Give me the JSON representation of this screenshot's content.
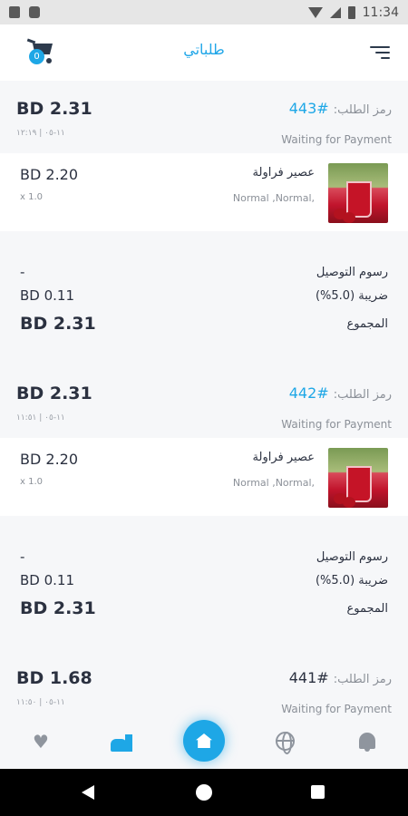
{
  "status_bar": {
    "time": "11:34"
  },
  "app_bar": {
    "title": "طلباتي",
    "cart_count": "0"
  },
  "orders": [
    {
      "price": "BD 2.31",
      "date": "١١-٠٥ | ١٢:١٩",
      "code_label": "رمز الطلب:",
      "code_number": "#443",
      "status": "Waiting for Payment",
      "item": {
        "price": "BD 2.20",
        "qty": "x 1.0",
        "name": "عصير فراولة",
        "options": "Normal ,Normal,"
      },
      "totals": {
        "delivery_label": "رسوم التوصيل",
        "delivery_value": "-",
        "tax_label": "ضريبة (5.0%)",
        "tax_value": "BD 0.11",
        "total_label": "المجموع",
        "total_value": "BD 2.31"
      }
    },
    {
      "price": "BD 2.31",
      "date": "١١-٠٥ | ١١:٥١",
      "code_label": "رمز الطلب:",
      "code_number": "#442",
      "status": "Waiting for Payment",
      "item": {
        "price": "BD 2.20",
        "qty": "x 1.0",
        "name": "عصير فراولة",
        "options": "Normal ,Normal,"
      },
      "totals": {
        "delivery_label": "رسوم التوصيل",
        "delivery_value": "-",
        "tax_label": "ضريبة (5.0%)",
        "tax_value": "BD 0.11",
        "total_label": "المجموع",
        "total_value": "BD 2.31"
      }
    },
    {
      "price": "BD 1.68",
      "date": "١١-٠٥ | ١١:٥٠",
      "code_label": "رمز الطلب:",
      "code_number": "#441",
      "status": "Waiting for Payment"
    }
  ],
  "colors": {
    "accent": "#1ea7e6",
    "text_dark": "#2b3140",
    "muted": "#8b9098"
  },
  "bottom_nav": [
    "heart-icon",
    "food-icon",
    "home-icon",
    "globe-icon",
    "bell-icon"
  ]
}
